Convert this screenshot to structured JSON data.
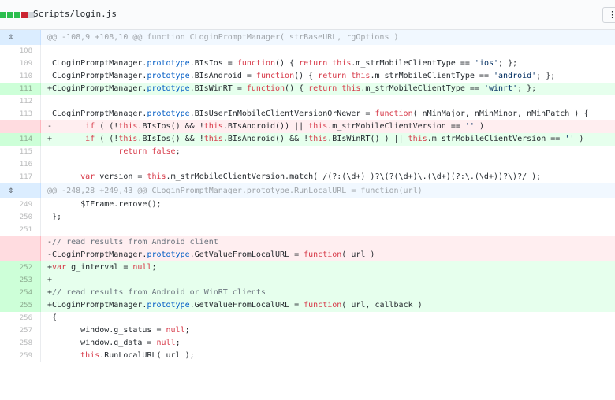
{
  "file": {
    "name": "Scripts/login.js",
    "view_label": "⋮"
  },
  "colors": {
    "add_bg": "#e6ffed",
    "del_bg": "#ffeef0",
    "hunk_bg": "#f1f8ff"
  },
  "icons": {
    "expand": "expand-icon"
  },
  "hunks": [
    "@@ -108,9 +108,10 @@ function CLoginPromptManager( strBaseURL, rgOptions )",
    "@@ -248,28 +249,43 @@ CLoginPromptManager.prototype.RunLocalURL = function(url)"
  ],
  "lines": {
    "l108": "108",
    "l109": "109",
    "l110": "110",
    "l111": "111",
    "l112": "112",
    "l113": "113",
    "l114": "114",
    "l115": "115",
    "l116": "116",
    "l117": "117",
    "l249": "249",
    "l250": "250",
    "l251": "251",
    "l252": "252",
    "l253": "253",
    "l254": "254",
    "l255": "255",
    "l256": "256",
    "l257": "257",
    "l258": "258",
    "l259": "259"
  },
  "code": {
    "c109": " CLoginPromptManager.prototype.BIsIos = function() { return this.m_strMobileClientType == 'ios'; };",
    "c110": " CLoginPromptManager.prototype.BIsAndroid = function() { return this.m_strMobileClientType == 'android'; };",
    "c111": "+CLoginPromptManager.prototype.BIsWinRT = function() { return this.m_strMobileClientType == 'winrt'; };",
    "c113": " CLoginPromptManager.prototype.BIsUserInMobileClientVersionOrNewer = function( nMinMajor, nMinMinor, nMinPatch ) {",
    "c113d": "-       if ( (!this.BIsIos() && !this.BIsAndroid()) || this.m_strMobileClientVersion == '' )",
    "c114": "+       if ( (!this.BIsIos() && !this.BIsAndroid() && !this.BIsWinRT() ) || this.m_strMobileClientVersion == '' )",
    "c115": "               return false;",
    "c117": "       var version = this.m_strMobileClientVersion.match( /(?:(\\d+) )?\\(?(\\d+)\\.(\\d+)(?:\\.(\\d+))?\\)?/ );",
    "c249": "       $IFrame.remove();",
    "c250": " };",
    "cd1": "-// read results from Android client",
    "cd2": "-CLoginPromptManager.prototype.GetValueFromLocalURL = function( url )",
    "c252": "+var g_interval = null;",
    "c253": "+",
    "c254": "+// read results from Android or WinRT clients",
    "c255": "+CLoginPromptManager.prototype.GetValueFromLocalURL = function( url, callback )",
    "c256": " {",
    "c257": "       window.g_status = null;",
    "c258": "       window.g_data = null;",
    "c259": "       this.RunLocalURL( url );"
  }
}
